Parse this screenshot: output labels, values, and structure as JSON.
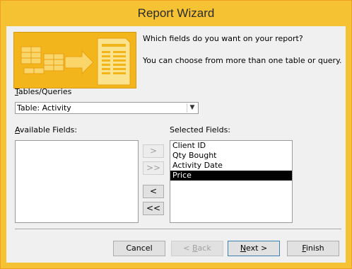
{
  "window": {
    "title": "Report Wizard"
  },
  "prompt": {
    "question": "Which fields do you want on your report?",
    "hint": "You can choose from more than one table or query."
  },
  "tables_queries": {
    "label_accel": "T",
    "label_rest": "ables/Queries",
    "selected": "Table: Activity"
  },
  "available_fields": {
    "label_accel": "A",
    "label_rest": "vailable Fields:",
    "items": []
  },
  "selected_fields": {
    "label": "Selected Fields:",
    "items": [
      "Client ID",
      "Qty Bought",
      "Activity Date",
      "Price"
    ],
    "selected_item": "Price"
  },
  "move_buttons": {
    "add_one": ">",
    "add_all": ">>",
    "remove_one": "<",
    "remove_all": "<<"
  },
  "footer": {
    "cancel": "Cancel",
    "back_accel": "< ",
    "back_u": "B",
    "back_rest": "ack",
    "next_u": "N",
    "next_rest": "ext >",
    "finish_u": "F",
    "finish_rest": "inish"
  },
  "colors": {
    "title_bar": "#f5c233",
    "client_bg": "#f0f0f0",
    "selection": "#000000"
  }
}
